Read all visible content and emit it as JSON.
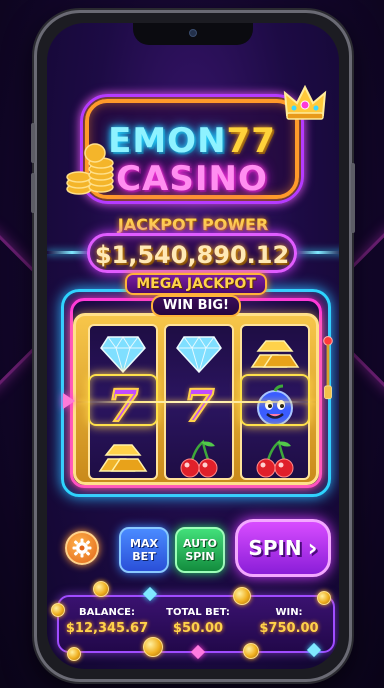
{
  "logo": {
    "line1_text": "EMON",
    "line1_number": "77",
    "line2_text": "CASINO"
  },
  "jackpot": {
    "title": "JACKPOT POWER",
    "amount": "$1,540,890.12"
  },
  "slot_machine": {
    "banner_title": "MEGA JACKPOT",
    "banner_subtitle": "WIN BIG!",
    "reels": [
      [
        "diamond",
        "seven",
        "gold-bar"
      ],
      [
        "diamond",
        "seven",
        "cherry"
      ],
      [
        "gold-bar",
        "blue-fruit",
        "cherry"
      ]
    ],
    "seven_symbol": "7"
  },
  "controls": {
    "settings_icon": "gear-icon",
    "max_bet_line1": "MAX",
    "max_bet_line2": "BET",
    "auto_spin_line1": "AUTO",
    "auto_spin_line2": "SPIN",
    "spin_label": "SPIN",
    "spin_arrow": "›"
  },
  "stats": {
    "balance_label": "BALANCE:",
    "balance_value": "$12,345.67",
    "total_bet_label": "TOTAL BET:",
    "total_bet_value": "$50.00",
    "win_label": "WIN:",
    "win_value": "$750.00"
  },
  "colors": {
    "accent_gold": "#ffd24a",
    "accent_cyan": "#2ad8ff",
    "accent_magenta": "#ff3ad8",
    "spin_purple": "#b03cf0",
    "max_bet_blue": "#3a6cf0",
    "auto_spin_green": "#2bc45a",
    "settings_orange": "#f07a24"
  }
}
